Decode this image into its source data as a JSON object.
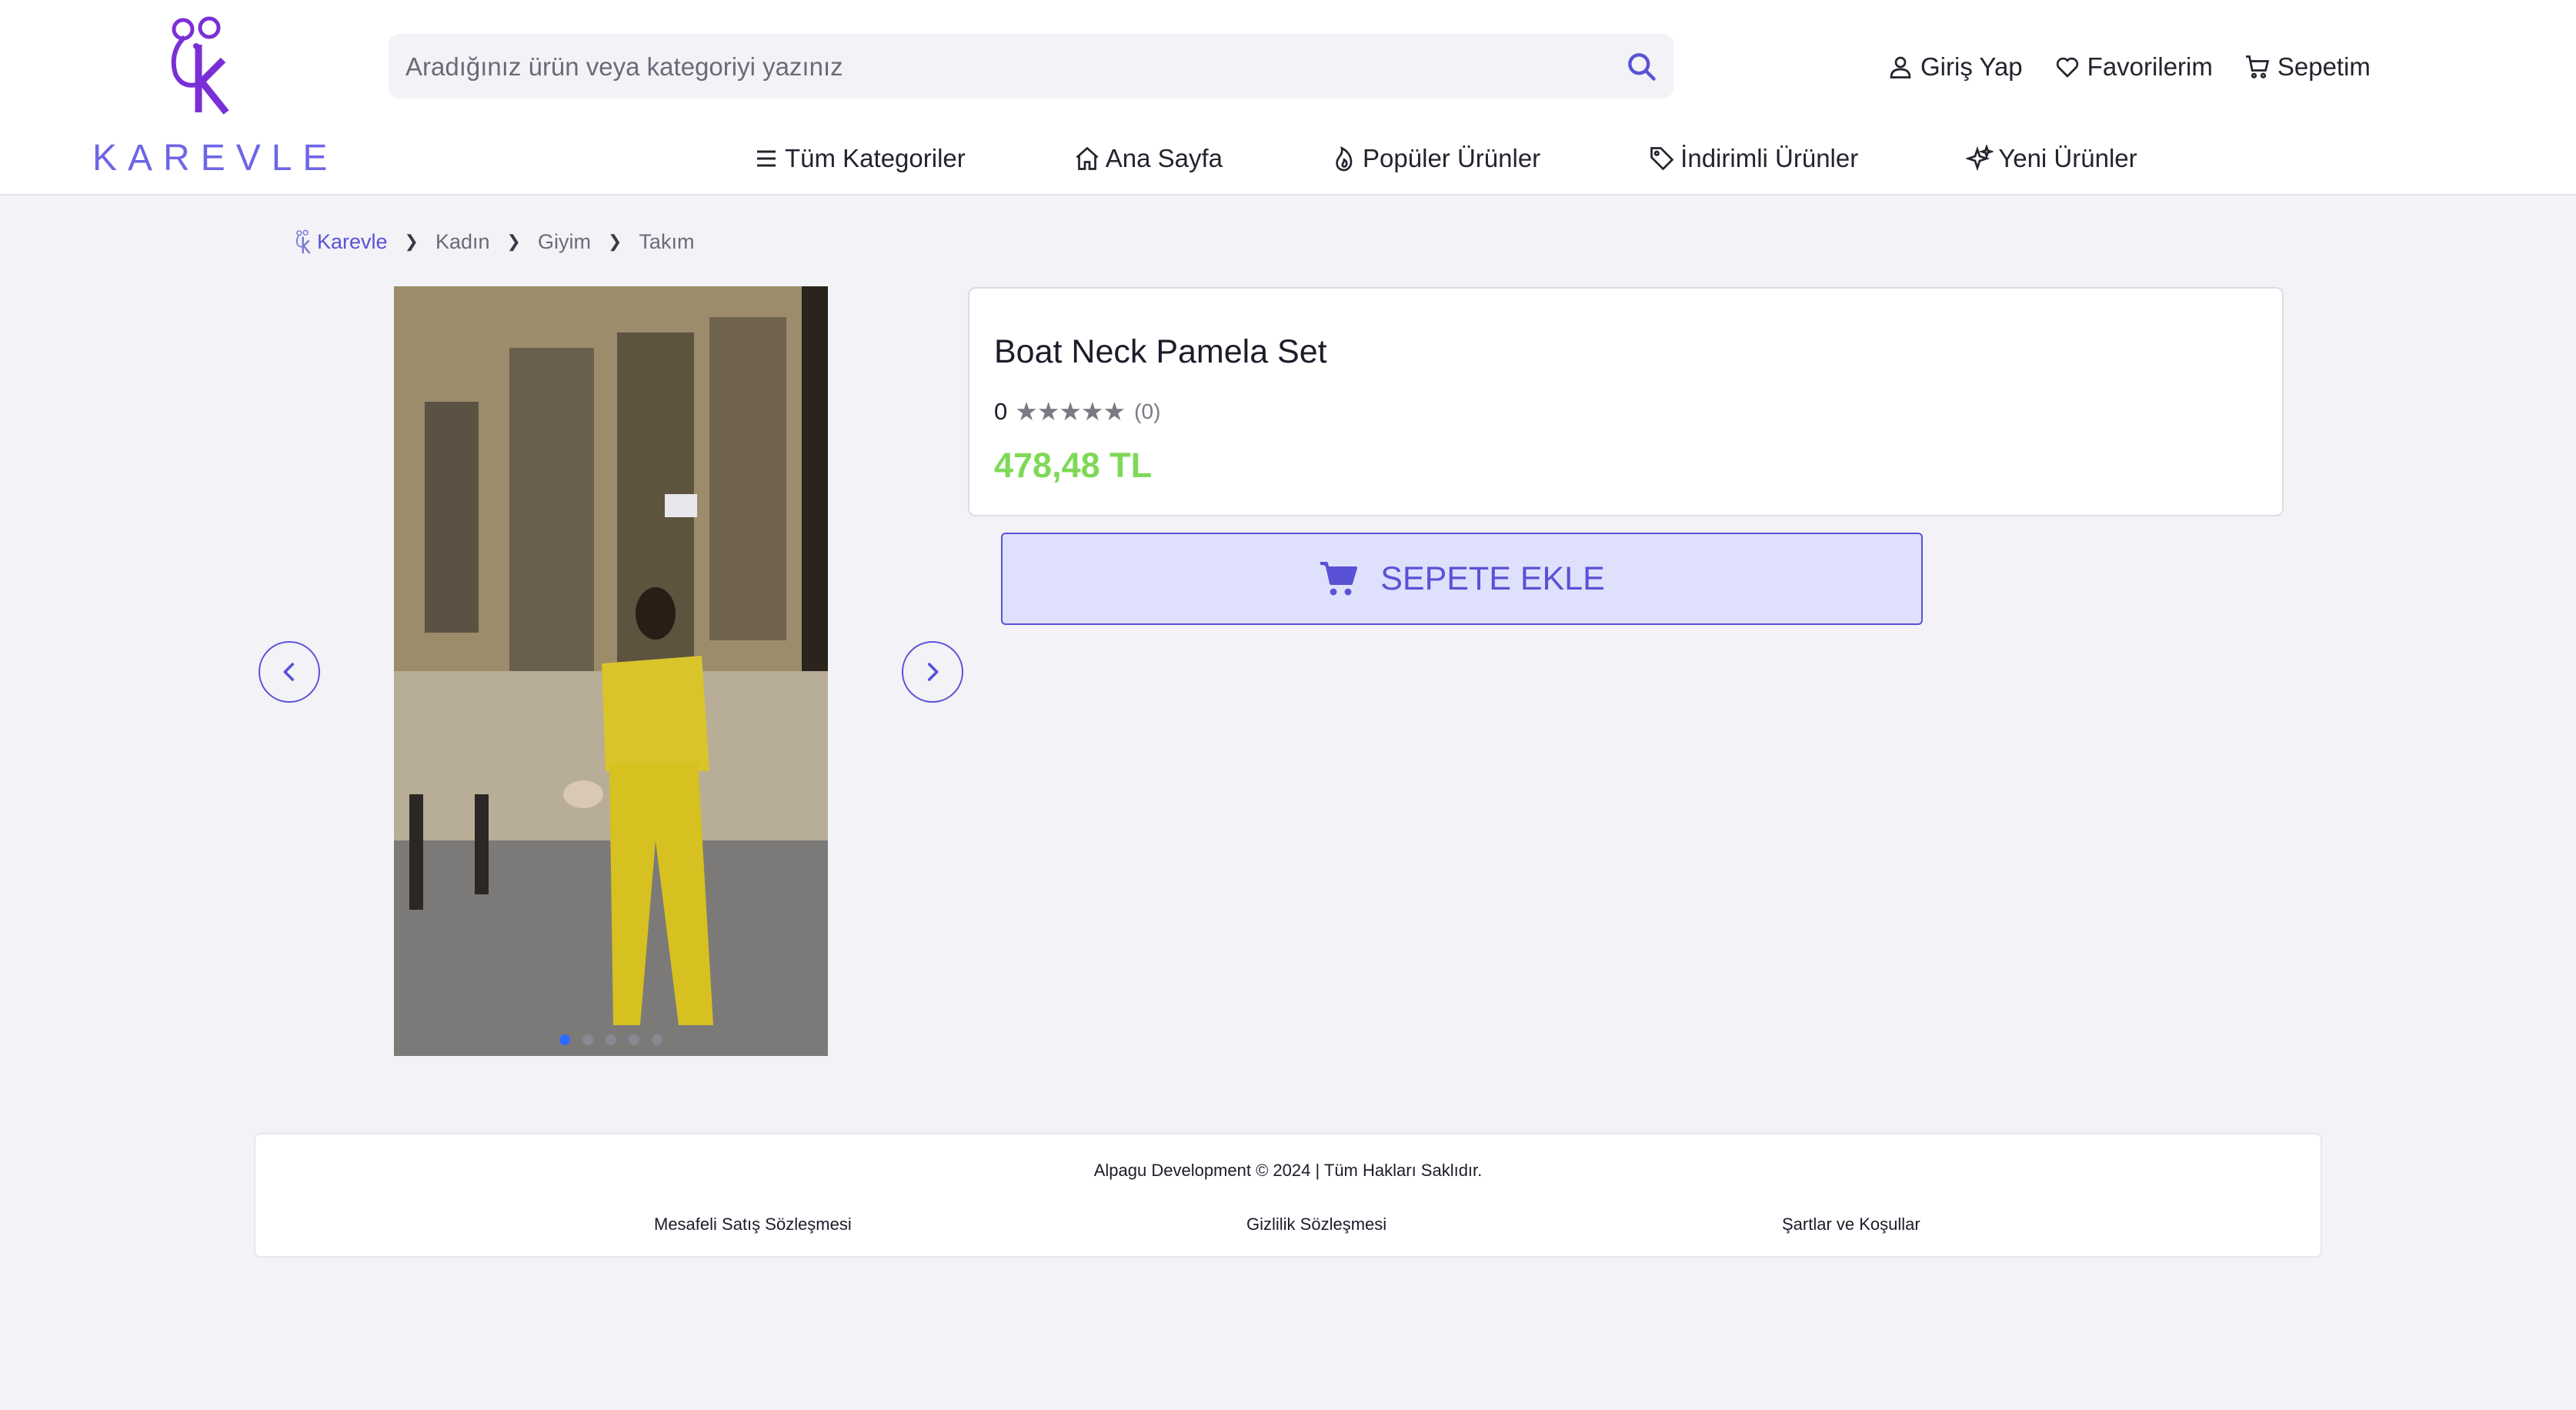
{
  "brand": {
    "name": "KAREVLE",
    "logo_color": "#6e66e6",
    "logo_mark_color": "#7a2fd6"
  },
  "search": {
    "placeholder": "Aradığınız ürün veya kategoriyi yazınız",
    "icon": "search-icon"
  },
  "user_links": [
    {
      "label": "Giriş Yap",
      "icon": "user-icon"
    },
    {
      "label": "Favorilerim",
      "icon": "heart-icon"
    },
    {
      "label": "Sepetim",
      "icon": "cart-icon"
    }
  ],
  "nav": [
    {
      "label": "Tüm Kategoriler",
      "icon": "menu-icon"
    },
    {
      "label": "Ana Sayfa",
      "icon": "home-icon"
    },
    {
      "label": "Popüler Ürünler",
      "icon": "flame-icon"
    },
    {
      "label": "İndirimli Ürünler",
      "icon": "tag-icon"
    },
    {
      "label": "Yeni Ürünler",
      "icon": "sparkles-icon"
    }
  ],
  "breadcrumb": [
    "Karevle",
    "Kadın",
    "Giyim",
    "Takım"
  ],
  "gallery": {
    "image_count": 5,
    "active_index": 0
  },
  "product": {
    "title": "Boat Neck Pamela Set",
    "rating": "0",
    "stars": "★★★★★",
    "review_count": "(0)",
    "price": "478,48 TL",
    "add_to_cart_label": "SEPETE EKLE"
  },
  "footer": {
    "copyright": "Alpagu Development © 2024 | Tüm Hakları Saklıdır.",
    "links": [
      "Mesafeli Satış Sözleşmesi",
      "Gizlilik Sözleşmesi",
      "Şartlar ve Koşullar"
    ]
  },
  "colors": {
    "accent": "#5a52d6",
    "price": "#7ed957",
    "button_bg": "#dfe0fb",
    "page_bg": "#f2f2f7"
  }
}
